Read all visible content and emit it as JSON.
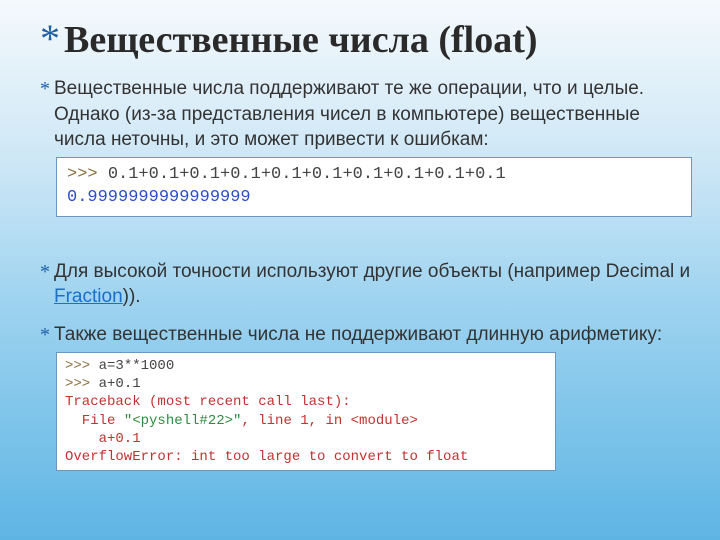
{
  "title": "Вещественные числа (float)",
  "bullets": {
    "b1": "Вещественные числа поддерживают те же операции, что и целые. Однако (из-за представления чисел в компьютере) вещественные числа неточны, и это может привести к ошибкам:",
    "b2_pre": "Для высокой точности используют другие объекты (например Decimal и ",
    "b2_link": "Fraction",
    "b2_post": ")).",
    "b3": "Также вещественные числа не поддерживают длинную арифметику:"
  },
  "code1": {
    "prompt": ">>> ",
    "expr": "0.1+0.1+0.1+0.1+0.1+0.1+0.1+0.1+0.1+0.1",
    "output": "0.9999999999999999"
  },
  "code2": {
    "l1p": ">>> ",
    "l1e": "a=3**1000",
    "l2p": ">>> ",
    "l2e": "a+0.1",
    "l3": "Traceback (most recent call last):",
    "l4a": "  File ",
    "l4b": "\"<pyshell#22>\"",
    "l4c": ", line 1, in ",
    "l4d": "<module>",
    "l5": "    a+0.1",
    "l6": "OverflowError: int too large to convert to float"
  }
}
